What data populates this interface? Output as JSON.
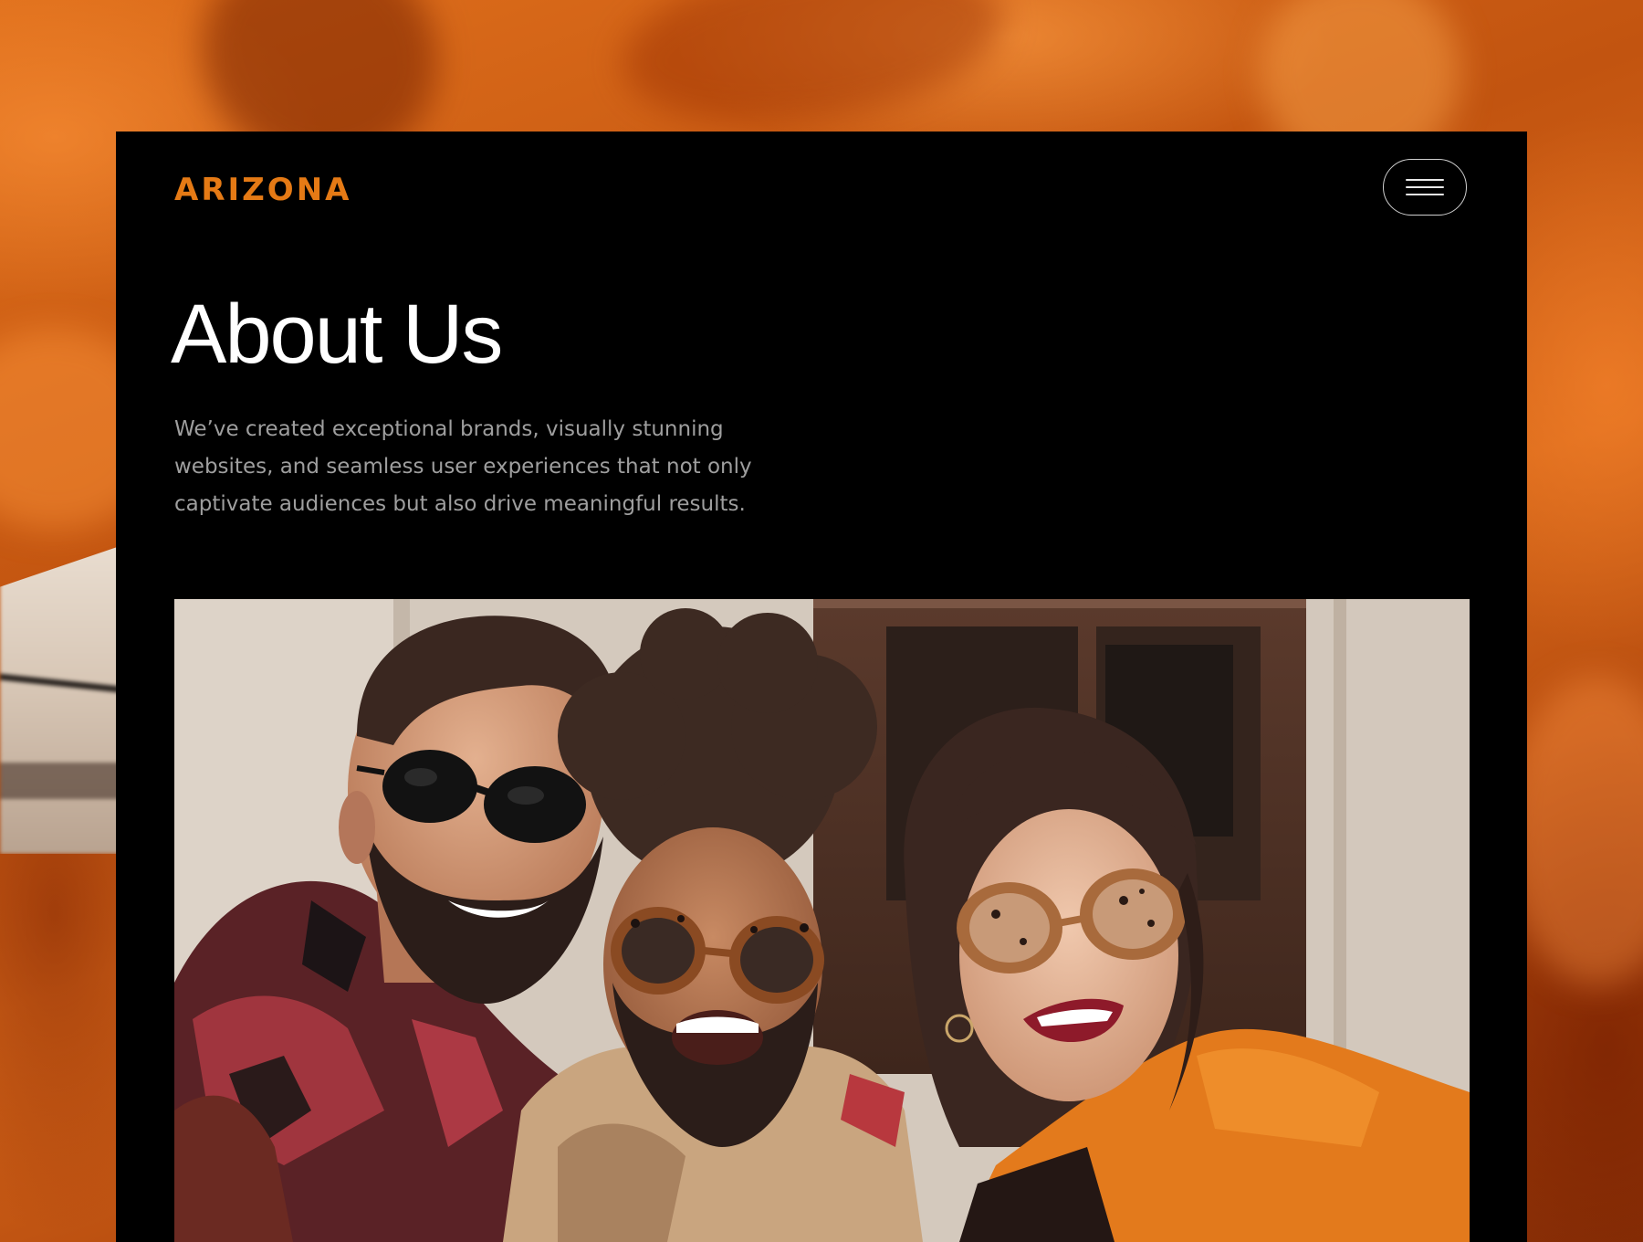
{
  "brand": {
    "logo_text": "ARIZONA",
    "accent_color": "#e57a15"
  },
  "header": {
    "menu_icon": "hamburger-menu-icon"
  },
  "hero": {
    "title": "About Us",
    "intro": "We’ve created exceptional brands, visually stunning websites, and seamless user experiences that not only captivate audiences but also drive meaningful results."
  },
  "team_photo": {
    "alt": "Three friends in sunglasses taking a smiling selfie outdoors"
  },
  "colors": {
    "page_background": "#000000",
    "backdrop": "#c9540c",
    "intro_text": "#9e9e9e"
  }
}
